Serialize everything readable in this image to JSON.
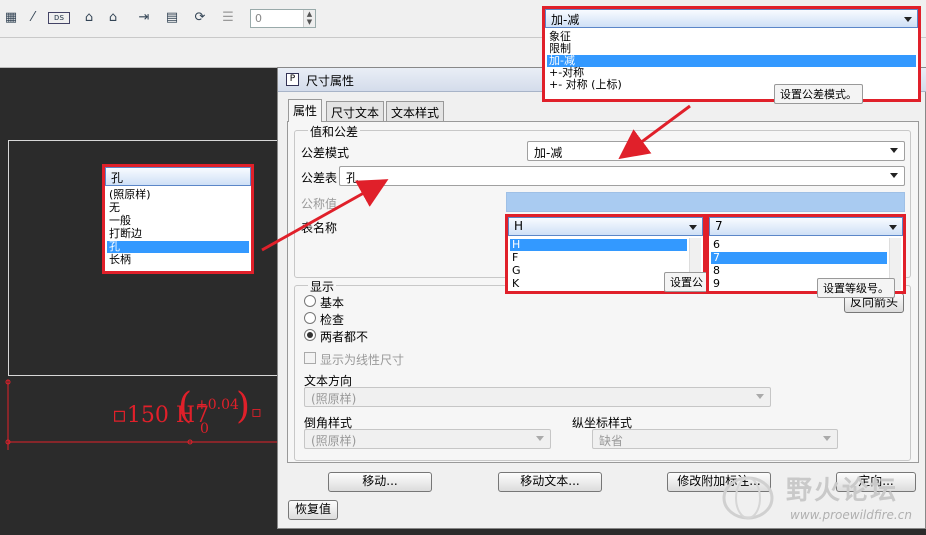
{
  "toolbar": {
    "spin_value": "0",
    "icons": [
      "grid-icon",
      "slash-icon",
      "ds-icon",
      "datum-a-icon",
      "datum-b-icon",
      "move-icon",
      "table-icon",
      "refresh-icon",
      "hatch-icon"
    ]
  },
  "drawing": {
    "dim_prefix": "▫150 H7",
    "tol_upper": "+0.04",
    "tol_lower": "0",
    "dim_suffix": "▫"
  },
  "dialog": {
    "title": "尺寸属性",
    "tabs": [
      "属性",
      "尺寸文本",
      "文本样式"
    ],
    "group_value": "值和公差",
    "tol_mode_label": "公差模式",
    "tol_mode_value": "加-减",
    "tol_table_label": "公差表",
    "tol_table_value": "孔",
    "nominal_label": "公称值",
    "table_name_label": "表名称",
    "group_display": "显示",
    "radio_basic": "基本",
    "radio_inspect": "检查",
    "radio_neither": "两者都不",
    "chk_linear": "显示为线性尺寸",
    "text_dir_label": "文本方向",
    "text_dir_value": "(照原样)",
    "chamfer_label": "倒角样式",
    "chamfer_value": "(照原样)",
    "ord_label": "纵坐标样式",
    "ord_value": "缺省",
    "btn_reverse": "反向箭头",
    "btn_move": "移动...",
    "btn_move_text": "移动文本...",
    "btn_modify": "修改附加标注...",
    "btn_orient": "定向...",
    "btn_restore": "恢复值"
  },
  "callout_mode": {
    "selected": "加-减",
    "options": [
      "象征",
      "限制",
      "加-减",
      "+-对称",
      "+- 对称 (上标)"
    ],
    "selected_index": 2,
    "tooltip": "设置公差模式。"
  },
  "callout_table": {
    "selected": "孔",
    "options": [
      "(照原样)",
      "无",
      "一般",
      "打断边",
      "孔",
      "长柄"
    ],
    "selected_index": 4
  },
  "callout_name": {
    "selected": "H",
    "options": [
      "H",
      "F",
      "G",
      "K"
    ],
    "selected_index": 0,
    "tooltip": "设置公"
  },
  "callout_grade": {
    "selected": "7",
    "options": [
      "6",
      "7",
      "8",
      "9"
    ],
    "selected_index": 1,
    "tooltip": "设置等级号。"
  },
  "watermark": {
    "text": "野火论坛",
    "url": "www.proewildfire.cn"
  },
  "colors": {
    "highlight": "#e0202a",
    "selection": "#3399ff",
    "dimension": "#e0202a"
  }
}
